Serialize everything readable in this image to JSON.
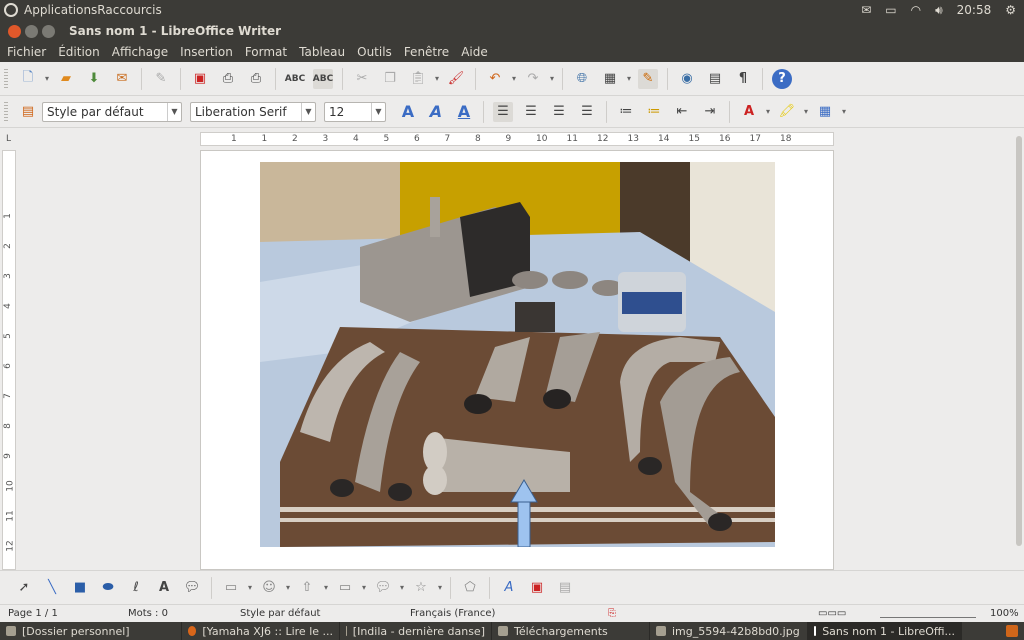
{
  "topbar": {
    "apps_label": "ApplicationsRaccourcis",
    "time": "20:58"
  },
  "window": {
    "title": "Sans nom 1 - LibreOffice Writer"
  },
  "menu": [
    "Fichier",
    "Édition",
    "Affichage",
    "Insertion",
    "Format",
    "Tableau",
    "Outils",
    "Fenêtre",
    "Aide"
  ],
  "format": {
    "style": "Style par défaut",
    "font": "Liberation Serif",
    "size": "12"
  },
  "ruler": {
    "h_ticks": [
      "1",
      "1",
      "2",
      "3",
      "4",
      "5",
      "6",
      "7",
      "8",
      "9",
      "10",
      "11",
      "12",
      "13",
      "14",
      "15",
      "16",
      "17",
      "18"
    ],
    "v_ticks": [
      "1",
      "2",
      "3",
      "4",
      "5",
      "6",
      "7",
      "8",
      "9",
      "10",
      "11",
      "12",
      "13"
    ]
  },
  "status": {
    "page": "Page 1 / 1",
    "words": "Mots : 0",
    "style": "Style par défaut",
    "language": "Français (France)",
    "zoom": "100%"
  },
  "taskbar": {
    "tasks": [
      "[Dossier personnel]",
      "[Yamaha XJ6 :: Lire le ...",
      "[Indila - dernière danse]",
      "Téléchargements",
      "img_5594-42b8bd0.jpg",
      "Sans nom 1 - LibreOffi..."
    ]
  }
}
